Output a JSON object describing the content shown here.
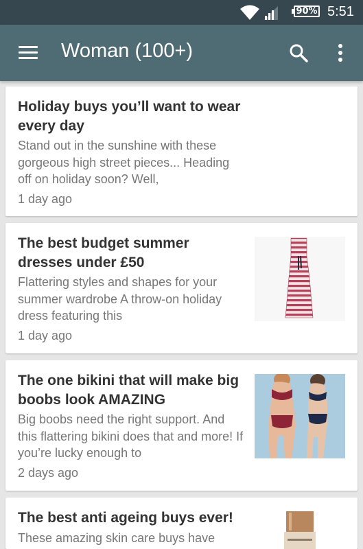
{
  "status_bar": {
    "battery": "90%",
    "time": "5:51"
  },
  "app_bar": {
    "title": "Woman (100+)",
    "menu_icon": "hamburger-menu-icon",
    "search_icon": "search-icon",
    "overflow_icon": "more-vert-icon"
  },
  "articles": [
    {
      "title": "Holiday buys you’ll want to wear every day",
      "summary": "Stand out in the sunshine with these gorgeous high street pieces... Heading off on holiday soon? Well,",
      "time": "1 day ago",
      "thumbnail": ""
    },
    {
      "title": "The best budget summer dresses under £50",
      "summary": "Flattering styles and shapes for your summer wardrobe A throw-on holiday dress featuring this",
      "time": "1 day ago",
      "thumbnail": "striped-maxi-dress"
    },
    {
      "title": "The one bikini that will make big boobs look AMAZING",
      "summary": "Big boobs need the right support. And this flattering bikini does that and more! If you’re lucky enough to",
      "time": "2 days ago",
      "thumbnail": "bikini-models"
    },
    {
      "title": "The best anti ageing buys ever!",
      "summary": "These amazing skin care buys have",
      "time": "",
      "thumbnail": "skincare-bottle"
    }
  ],
  "colors": {
    "status_bar": "#37474f",
    "app_bar": "#4f6c75",
    "background": "#e6e6e6",
    "card": "#ffffff",
    "title_text": "#333333",
    "secondary_text": "#777777"
  }
}
